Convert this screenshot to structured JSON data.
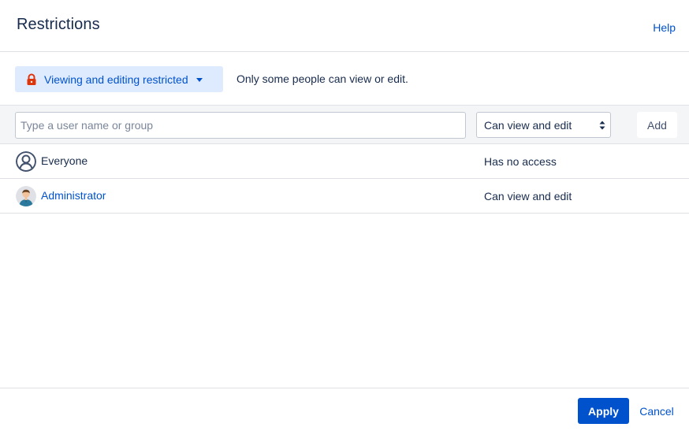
{
  "dialog": {
    "title": "Restrictions",
    "help_label": "Help"
  },
  "restriction_mode": {
    "icon": "lock-icon",
    "selected_label": "Viewing and editing restricted",
    "description": "Only some people can view or edit."
  },
  "add_bar": {
    "input_value": "",
    "input_placeholder": "Type a user name or group",
    "permission_selected": "Can view and edit",
    "add_label": "Add"
  },
  "entries": [
    {
      "name": "Everyone",
      "avatar": "group-avatar-icon",
      "permission": "Has no access",
      "is_link": false
    },
    {
      "name": "Administrator",
      "avatar": "user-avatar",
      "permission": "Can view and edit",
      "is_link": true
    }
  ],
  "footer": {
    "apply_label": "Apply",
    "cancel_label": "Cancel"
  },
  "colors": {
    "primary": "#0052cc",
    "dropdown_bg": "#deebff",
    "lock": "#de350b",
    "text": "#172b4d",
    "border": "#dfe1e6",
    "bar_bg": "#f4f5f7"
  }
}
